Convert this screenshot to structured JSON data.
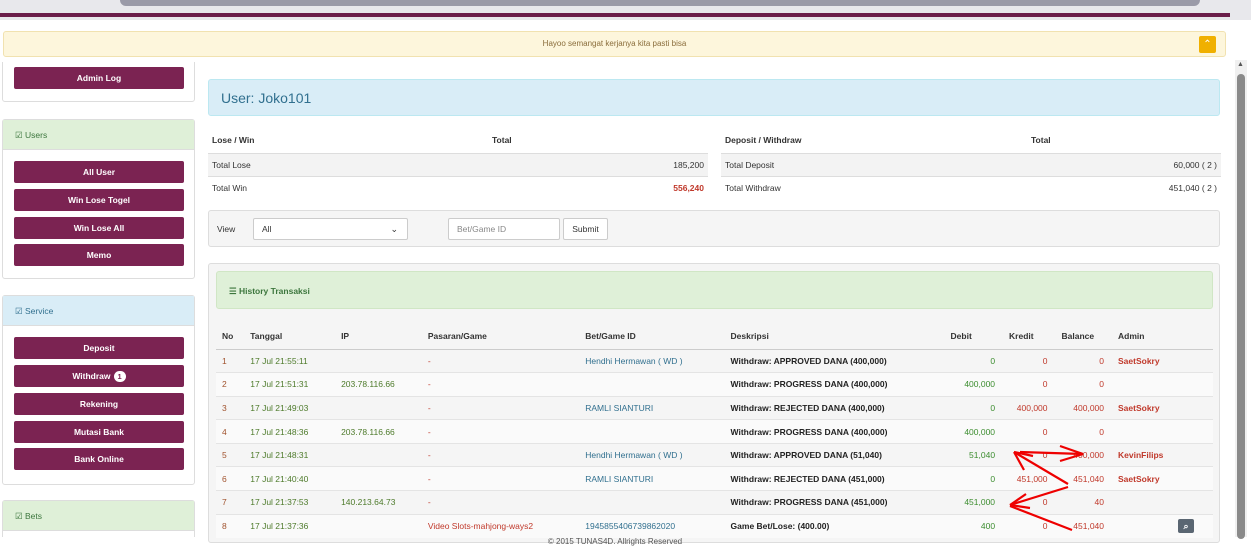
{
  "notice": "Hayoo semangat kerjanya kita pasti bisa",
  "sidebar": {
    "admin_log": "Admin Log",
    "users_title": "Users",
    "users_items": [
      "All User",
      "Win Lose Togel",
      "Win Lose All",
      "Memo"
    ],
    "service_title": "Service",
    "deposit": "Deposit",
    "withdraw": "Withdraw",
    "withdraw_badge": "1",
    "rekening": "Rekening",
    "mutasi": "Mutasi Bank",
    "bank_online": "Bank Online",
    "bets_title": "Bets"
  },
  "user_title": "User: Joko101",
  "lose_win": {
    "h1": "Lose / Win",
    "h2": "Total",
    "total_lose_label": "Total Lose",
    "total_lose": "185,200",
    "total_win_label": "Total Win",
    "total_win": "556,240"
  },
  "dep_wd": {
    "h1": "Deposit / Withdraw",
    "h2": "Total",
    "total_deposit_label": "Total Deposit",
    "total_deposit": "60,000 ( 2 )",
    "total_withdraw_label": "Total Withdraw",
    "total_withdraw": "451,040 ( 2 )"
  },
  "filter": {
    "view_label": "View",
    "view_value": "All",
    "bet_placeholder": "Bet/Game ID",
    "submit": "Submit"
  },
  "history_title": "History Transaksi",
  "columns": [
    "No",
    "Tanggal",
    "IP",
    "Pasaran/Game",
    "Bet/Game ID",
    "Deskripsi",
    "Debit",
    "Kredit",
    "Balance",
    "Admin"
  ],
  "rows": [
    {
      "no": "1",
      "tanggal": "17 Jul 21:55:11",
      "ip": "",
      "pasaran": "-",
      "bet": "Hendhi Hermawan ( WD )",
      "desc": "Withdraw: APPROVED DANA (400,000)",
      "debit": "0",
      "kredit": "0",
      "balance": "0",
      "admin": "SaetSokry"
    },
    {
      "no": "2",
      "tanggal": "17 Jul 21:51:31",
      "ip": "203.78.116.66",
      "pasaran": "-",
      "bet": "",
      "desc": "Withdraw: PROGRESS DANA (400,000)",
      "debit": "400,000",
      "kredit": "0",
      "balance": "0",
      "admin": ""
    },
    {
      "no": "3",
      "tanggal": "17 Jul 21:49:03",
      "ip": "",
      "pasaran": "-",
      "bet": "RAMLI SIANTURI",
      "desc": "Withdraw: REJECTED DANA (400,000)",
      "debit": "0",
      "kredit": "400,000",
      "balance": "400,000",
      "admin": "SaetSokry"
    },
    {
      "no": "4",
      "tanggal": "17 Jul 21:48:36",
      "ip": "203.78.116.66",
      "pasaran": "-",
      "bet": "",
      "desc": "Withdraw: PROGRESS DANA (400,000)",
      "debit": "400,000",
      "kredit": "0",
      "balance": "0",
      "admin": ""
    },
    {
      "no": "5",
      "tanggal": "17 Jul 21:48:31",
      "ip": "",
      "pasaran": "-",
      "bet": "Hendhi Hermawan ( WD )",
      "desc": "Withdraw: APPROVED DANA (51,040)",
      "debit": "51,040",
      "kredit": "0",
      "balance": "400,000",
      "admin": "KevinFilips"
    },
    {
      "no": "6",
      "tanggal": "17 Jul 21:40:40",
      "ip": "",
      "pasaran": "-",
      "bet": "RAMLI SIANTURI",
      "desc": "Withdraw: REJECTED DANA (451,000)",
      "debit": "0",
      "kredit": "451,000",
      "balance": "451,040",
      "admin": "SaetSokry"
    },
    {
      "no": "7",
      "tanggal": "17 Jul 21:37:53",
      "ip": "140.213.64.73",
      "pasaran": "-",
      "bet": "",
      "desc": "Withdraw: PROGRESS DANA (451,000)",
      "debit": "451,000",
      "kredit": "0",
      "balance": "40",
      "admin": ""
    },
    {
      "no": "8",
      "tanggal": "17 Jul 21:37:36",
      "ip": "",
      "pasaran": "Video Slots-mahjong-ways2",
      "bet": "1945855406739862020",
      "desc": "Game Bet/Lose: (400.00)",
      "debit": "400",
      "kredit": "0",
      "balance": "451,040",
      "admin": ""
    }
  ],
  "footer": "© 2015 TUNAS4D. Allrights Reserved"
}
